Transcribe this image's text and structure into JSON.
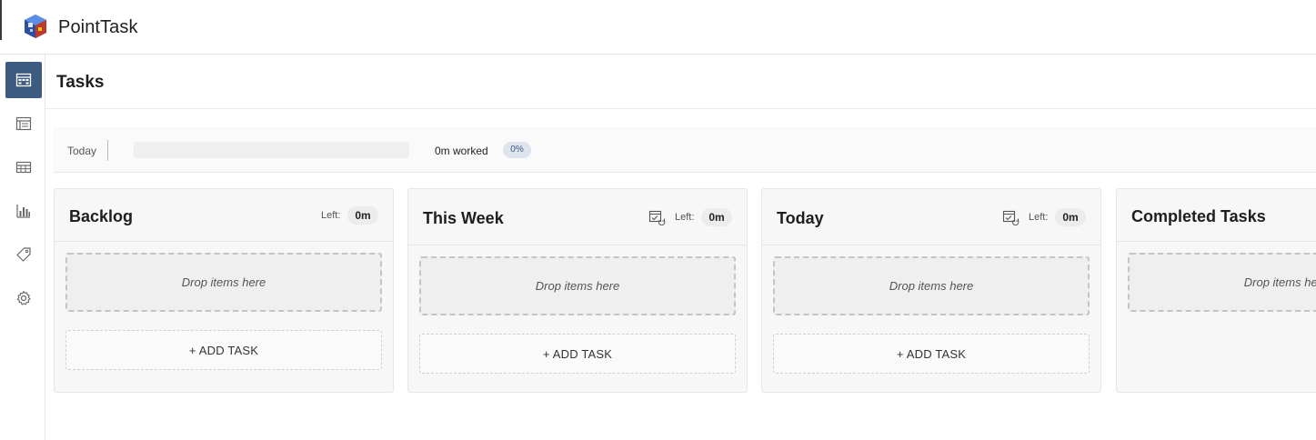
{
  "app": {
    "title": "PointTask"
  },
  "page": {
    "title": "Tasks"
  },
  "today_bar": {
    "label": "Today",
    "progress": 0,
    "worked": "0m worked",
    "percent": "0%"
  },
  "columns": [
    {
      "title": "Backlog",
      "left_label": "Left:",
      "left_value": "0m",
      "drop_text": "Drop items here",
      "add_label": "+ ADD TASK"
    },
    {
      "title": "This Week",
      "left_label": "Left:",
      "left_value": "0m",
      "drop_text": "Drop items here",
      "add_label": "+ ADD TASK"
    },
    {
      "title": "Today",
      "left_label": "Left:",
      "left_value": "0m",
      "drop_text": "Drop items here",
      "add_label": "+ ADD TASK"
    },
    {
      "title": "Completed Tasks",
      "drop_text": "Drop items here"
    }
  ],
  "sidebar": {
    "items": [
      {
        "icon": "board-icon",
        "active": true
      },
      {
        "icon": "list-icon",
        "active": false
      },
      {
        "icon": "table-icon",
        "active": false
      },
      {
        "icon": "chart-icon",
        "active": false
      },
      {
        "icon": "tag-icon",
        "active": false
      },
      {
        "icon": "gear-icon",
        "active": false
      }
    ]
  },
  "colors": {
    "accent": "#3d5a80",
    "border": "#e6e6e6",
    "panel": "#f7f7f7"
  }
}
